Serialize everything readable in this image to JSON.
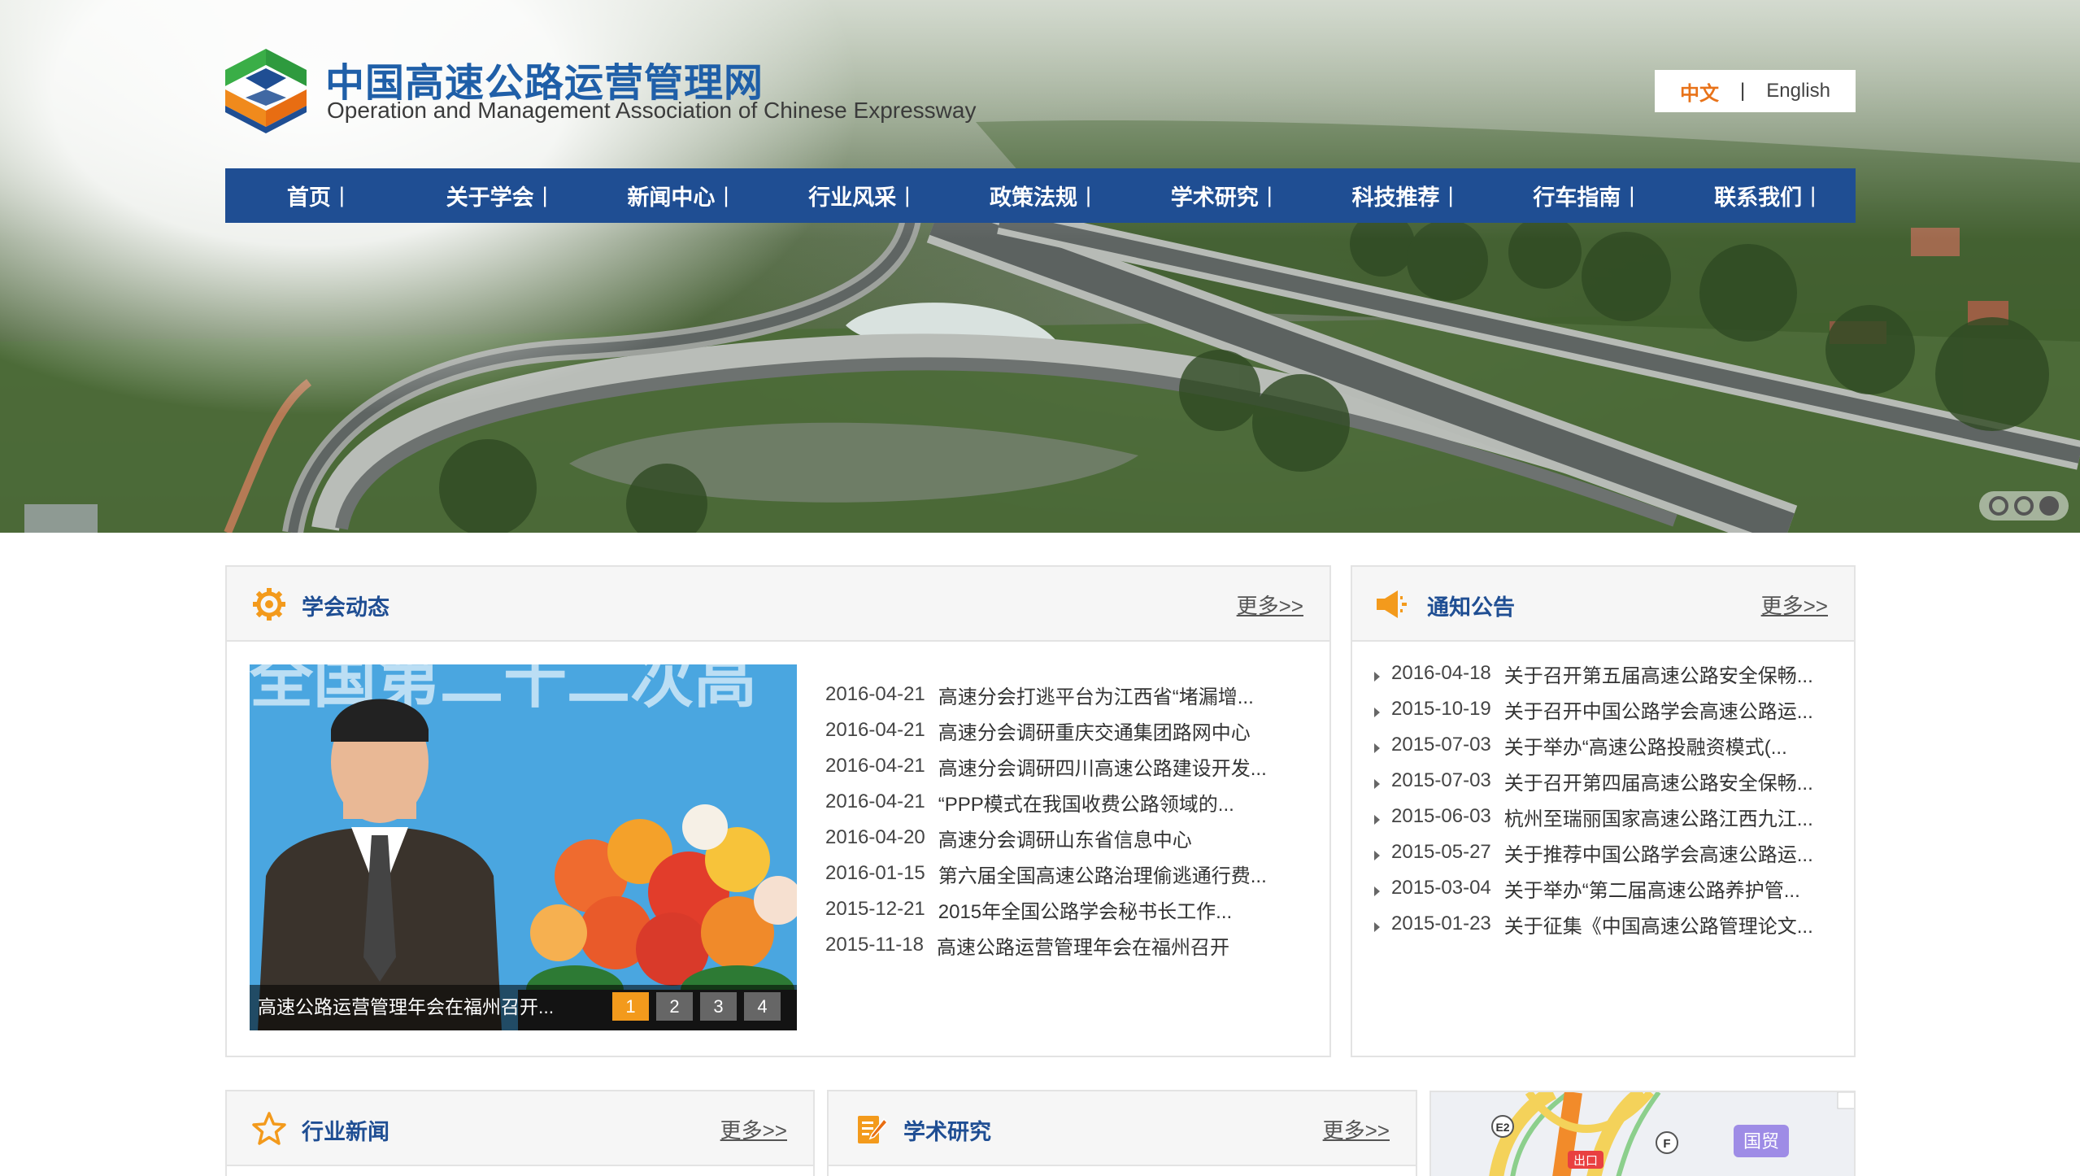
{
  "site": {
    "title": "中国高速公路运营管理网",
    "subtitle": "Operation and Management Association of Chinese Expressway"
  },
  "lang": {
    "zh": "中文",
    "sep": "|",
    "en": "English"
  },
  "nav": {
    "items": [
      {
        "label": "首页",
        "bar": "|"
      },
      {
        "label": "关于学会",
        "bar": "|"
      },
      {
        "label": "新闻中心",
        "bar": "|"
      },
      {
        "label": "行业风采",
        "bar": "|"
      },
      {
        "label": "政策法规",
        "bar": "|"
      },
      {
        "label": "学术研究",
        "bar": "|"
      },
      {
        "label": "科技推荐",
        "bar": "|"
      },
      {
        "label": "行车指南",
        "bar": "|"
      },
      {
        "label": "联系我们",
        "bar": "|"
      }
    ]
  },
  "banner": {
    "dot_count": 3,
    "active_dot": 3
  },
  "association": {
    "title": "学会动态",
    "more": "更多>>",
    "slider": {
      "caption": "高速公路运营管理年会在福州召开...",
      "pages": [
        "1",
        "2",
        "3",
        "4"
      ],
      "active_page": 1,
      "banner_text": "全国第二十二次高"
    },
    "items": [
      {
        "date": "2016-04-21",
        "text": "高速分会打逃平台为江西省“堵漏增..."
      },
      {
        "date": "2016-04-21",
        "text": "高速分会调研重庆交通集团路网中心"
      },
      {
        "date": "2016-04-21",
        "text": "高速分会调研四川高速公路建设开发..."
      },
      {
        "date": "2016-04-21",
        "text": "“PPP模式在我国收费公路领域的..."
      },
      {
        "date": "2016-04-20",
        "text": "高速分会调研山东省信息中心"
      },
      {
        "date": "2016-01-15",
        "text": "第六届全国高速公路治理偷逃通行费..."
      },
      {
        "date": "2015-12-21",
        "text": "2015年全国公路学会秘书长工作..."
      },
      {
        "date": "2015-11-18",
        "text": "高速公路运营管理年会在福州召开"
      }
    ]
  },
  "notice": {
    "title": "通知公告",
    "more": "更多>>",
    "items": [
      {
        "date": "2016-04-18",
        "text": "关于召开第五届高速公路安全保畅..."
      },
      {
        "date": "2015-10-19",
        "text": "关于召开中国公路学会高速公路运..."
      },
      {
        "date": "2015-07-03",
        "text": "关于举办“高速公路投融资模式(..."
      },
      {
        "date": "2015-07-03",
        "text": "关于召开第四届高速公路安全保畅..."
      },
      {
        "date": "2015-06-03",
        "text": "杭州至瑞丽国家高速公路江西九江..."
      },
      {
        "date": "2015-05-27",
        "text": "关于推荐中国公路学会高速公路运..."
      },
      {
        "date": "2015-03-04",
        "text": "关于举办“第二届高速公路养护管..."
      },
      {
        "date": "2015-01-23",
        "text": "关于征集《中国高速公路管理论文..."
      }
    ]
  },
  "industry": {
    "title": "行业新闻",
    "more": "更多>>"
  },
  "academic": {
    "title": "学术研究",
    "more": "更多>>"
  },
  "map": {
    "labels": [
      "国贸",
      "出口",
      "E2",
      "F"
    ]
  },
  "colors": {
    "brand_blue": "#1f4e93",
    "accent_orange": "#f39a1c"
  }
}
